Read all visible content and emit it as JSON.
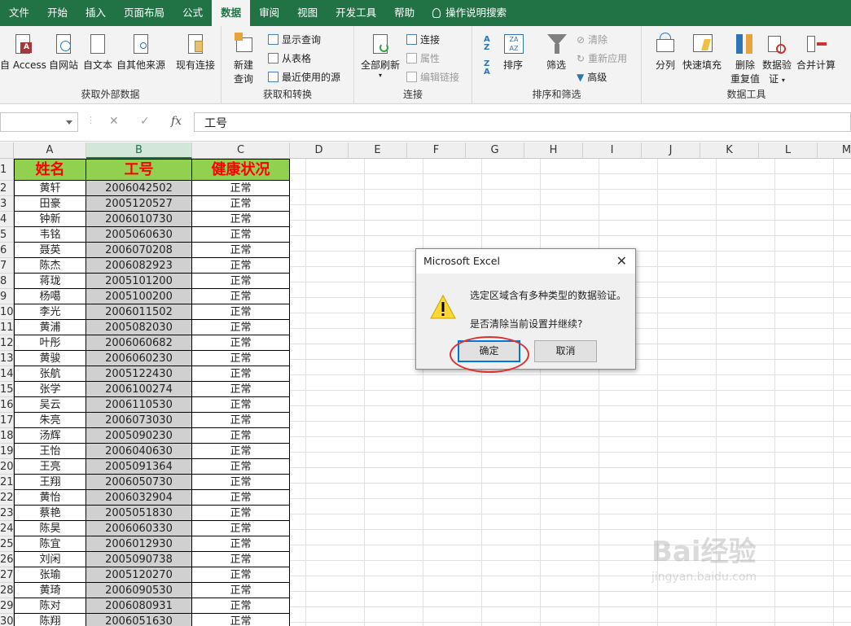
{
  "menubar": {
    "items": [
      "文件",
      "开始",
      "插入",
      "页面布局",
      "公式",
      "数据",
      "审阅",
      "视图",
      "开发工具",
      "帮助"
    ],
    "active": "数据",
    "tell_me": "操作说明搜索"
  },
  "ribbon": {
    "get_external": {
      "label": "获取外部数据",
      "access": "自 Access",
      "web": "自网站",
      "text": "自文本",
      "other": "自其他来源",
      "existing": "现有连接"
    },
    "get_transform": {
      "label": "获取和转换",
      "new_query_1": "新建",
      "new_query_2": "查询",
      "show_queries": "显示查询",
      "from_table": "从表格",
      "recent_sources": "最近使用的源"
    },
    "connections": {
      "label": "连接",
      "refresh_all": "全部刷新",
      "connections": "连接",
      "properties": "属性",
      "edit_links": "编辑链接"
    },
    "sort_filter": {
      "label": "排序和筛选",
      "sort": "排序",
      "filter": "筛选",
      "clear": "清除",
      "reapply": "重新应用",
      "advanced": "高级"
    },
    "data_tools": {
      "label": "数据工具",
      "text_to_columns": "分列",
      "flash_fill": "快速填充",
      "remove_dup_1": "删除",
      "remove_dup_2": "重复值",
      "validation_1": "数据验",
      "validation_2": "证",
      "consolidate": "合并计算"
    }
  },
  "formula_bar": {
    "value": "工号"
  },
  "columns": [
    "A",
    "B",
    "C",
    "D",
    "E",
    "F",
    "G",
    "H",
    "I",
    "J",
    "K",
    "L",
    "M"
  ],
  "headers": {
    "name": "姓名",
    "id": "工号",
    "health": "健康状况"
  },
  "rows": [
    {
      "r": "2",
      "name": "黄轩",
      "id": "2006042502",
      "status": "正常"
    },
    {
      "r": "3",
      "name": "田豪",
      "id": "2005120527",
      "status": "正常"
    },
    {
      "r": "4",
      "name": "钟新",
      "id": "2006010730",
      "status": "正常"
    },
    {
      "r": "5",
      "name": "韦铭",
      "id": "2005060630",
      "status": "正常"
    },
    {
      "r": "6",
      "name": "聂英",
      "id": "2006070208",
      "status": "正常"
    },
    {
      "r": "7",
      "name": "陈杰",
      "id": "2006082923",
      "status": "正常"
    },
    {
      "r": "8",
      "name": "蒋珑",
      "id": "2005101200",
      "status": "正常"
    },
    {
      "r": "9",
      "name": "杨噶",
      "id": "2005100200",
      "status": "正常"
    },
    {
      "r": "10",
      "name": "李光",
      "id": "2006011502",
      "status": "正常"
    },
    {
      "r": "11",
      "name": "黄浦",
      "id": "2005082030",
      "status": "正常"
    },
    {
      "r": "12",
      "name": "叶彤",
      "id": "2006060682",
      "status": "正常"
    },
    {
      "r": "13",
      "name": "黄骏",
      "id": "2006060230",
      "status": "正常"
    },
    {
      "r": "14",
      "name": "张航",
      "id": "2005122430",
      "status": "正常"
    },
    {
      "r": "15",
      "name": "张学",
      "id": "2006100274",
      "status": "正常"
    },
    {
      "r": "16",
      "name": "吴云",
      "id": "2006110530",
      "status": "正常"
    },
    {
      "r": "17",
      "name": "朱亮",
      "id": "2006073030",
      "status": "正常"
    },
    {
      "r": "18",
      "name": "汤辉",
      "id": "2005090230",
      "status": "正常"
    },
    {
      "r": "19",
      "name": "王怡",
      "id": "2006040630",
      "status": "正常"
    },
    {
      "r": "20",
      "name": "王亮",
      "id": "2005091364",
      "status": "正常"
    },
    {
      "r": "21",
      "name": "王翔",
      "id": "2006050730",
      "status": "正常"
    },
    {
      "r": "22",
      "name": "黄怡",
      "id": "2006032904",
      "status": "正常"
    },
    {
      "r": "23",
      "name": "蔡艳",
      "id": "2005051830",
      "status": "正常"
    },
    {
      "r": "24",
      "name": "陈昊",
      "id": "2006060330",
      "status": "正常"
    },
    {
      "r": "25",
      "name": "陈宜",
      "id": "2006012930",
      "status": "正常"
    },
    {
      "r": "26",
      "name": "刘闲",
      "id": "2005090738",
      "status": "正常"
    },
    {
      "r": "27",
      "name": "张瑜",
      "id": "2005120270",
      "status": "正常"
    },
    {
      "r": "28",
      "name": "黄琦",
      "id": "2006090530",
      "status": "正常"
    },
    {
      "r": "29",
      "name": "陈对",
      "id": "2006080931",
      "status": "正常"
    },
    {
      "r": "30",
      "name": "陈翔",
      "id": "2006051630",
      "status": "正常"
    }
  ],
  "dialog": {
    "title": "Microsoft Excel",
    "message": "选定区域含有多种类型的数据验证。",
    "question": "是否清除当前设置并继续?",
    "ok": "确定",
    "cancel": "取消"
  },
  "watermark": {
    "text": "Bai经验",
    "sub": "jingyan.baidu.com"
  }
}
